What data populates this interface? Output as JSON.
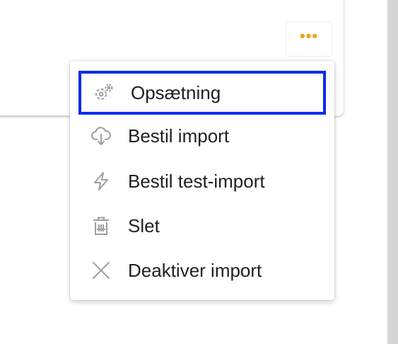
{
  "toolbar": {
    "more_label": "•••"
  },
  "menu": {
    "items": [
      {
        "label": "Opsætning",
        "icon": "gear-cog-icon",
        "focused": true
      },
      {
        "label": "Bestil import",
        "icon": "cloud-download-icon",
        "focused": false
      },
      {
        "label": "Bestil test-import",
        "icon": "lightning-icon",
        "focused": false
      },
      {
        "label": "Slet",
        "icon": "trash-icon",
        "focused": false
      },
      {
        "label": "Deaktiver import",
        "icon": "close-icon",
        "focused": false
      }
    ]
  },
  "colors": {
    "accent": "#f0a020",
    "focus_outline": "#0a2af0",
    "icon_gray": "#9e9e9e",
    "text": "#202020"
  }
}
